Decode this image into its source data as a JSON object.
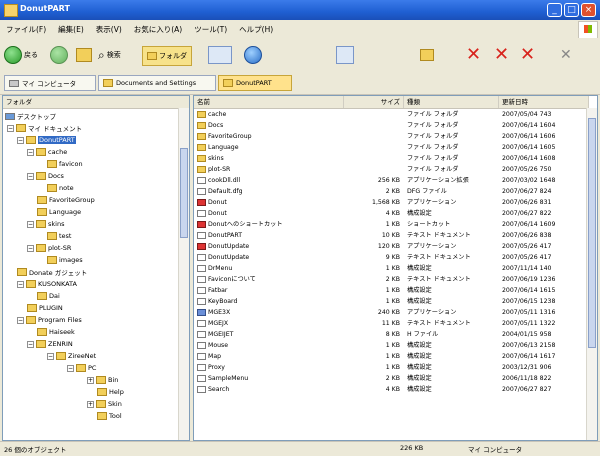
{
  "window": {
    "title": "DonutPART"
  },
  "menu": [
    "ファイル(F)",
    "編集(E)",
    "表示(V)",
    "お気に入り(A)",
    "ツール(T)",
    "ヘルプ(H)"
  ],
  "toolbar": {
    "back_label": "戻る",
    "search_label": "検索",
    "folder_label": "フォルダ"
  },
  "address": {
    "tab1": "マイ コンピュータ",
    "tab2": "Documents and Settings",
    "tab3": "DonutPART"
  },
  "tree": {
    "header": "フォルダ",
    "items": [
      {
        "label": "デスクトップ"
      },
      {
        "label": "マイ ドキュメント"
      },
      {
        "label": "DonutPART"
      },
      {
        "label": "cache"
      },
      {
        "label": "favicon"
      },
      {
        "label": "Docs"
      },
      {
        "label": "note"
      },
      {
        "label": "FavoriteGroup"
      },
      {
        "label": "Language"
      },
      {
        "label": "skins"
      },
      {
        "label": "test"
      },
      {
        "label": "plot-SR"
      },
      {
        "label": "images"
      },
      {
        "label": "Donate ガジェット"
      },
      {
        "label": "KUSONKATA"
      },
      {
        "label": "Dai"
      },
      {
        "label": "PLUGIN"
      },
      {
        "label": "Program Files"
      },
      {
        "label": "Haiseek"
      },
      {
        "label": "ZENRIN"
      },
      {
        "label": "ZireeNet"
      },
      {
        "label": "PC"
      },
      {
        "label": "Bin"
      },
      {
        "label": "Help"
      },
      {
        "label": "Skin"
      },
      {
        "label": "Tool"
      }
    ]
  },
  "list": {
    "columns": [
      "名前",
      "サイズ",
      "種類",
      "更新日時"
    ],
    "rows": [
      {
        "name": "cache",
        "size": "",
        "type": "ファイル フォルダ",
        "date": "2007/05/04 743"
      },
      {
        "name": "Docs",
        "size": "",
        "type": "ファイル フォルダ",
        "date": "2007/06/14 1604"
      },
      {
        "name": "FavoriteGroup",
        "size": "",
        "type": "ファイル フォルダ",
        "date": "2007/06/14 1606"
      },
      {
        "name": "Language",
        "size": "",
        "type": "ファイル フォルダ",
        "date": "2007/06/14 1605"
      },
      {
        "name": "skins",
        "size": "",
        "type": "ファイル フォルダ",
        "date": "2007/06/14 1608"
      },
      {
        "name": "plot-SR",
        "size": "",
        "type": "ファイル フォルダ",
        "date": "2007/05/26 750"
      },
      {
        "name": "cookDll.dll",
        "size": "256 KB",
        "type": "アプリケーション拡張",
        "date": "2007/03/02 1648"
      },
      {
        "name": "Default.dfg",
        "size": "2 KB",
        "type": "DFG ファイル",
        "date": "2007/06/27 824"
      },
      {
        "name": "Donut",
        "size": "1,568 KB",
        "type": "アプリケーション",
        "date": "2007/06/26 831"
      },
      {
        "name": "Donut",
        "size": "4 KB",
        "type": "構成設定",
        "date": "2007/06/27 822"
      },
      {
        "name": "Donutへのショートカット",
        "size": "1 KB",
        "type": "ショートカット",
        "date": "2007/06/14 1609"
      },
      {
        "name": "DonutPART",
        "size": "10 KB",
        "type": "テキスト ドキュメント",
        "date": "2007/06/26 838"
      },
      {
        "name": "DonutUpdate",
        "size": "120 KB",
        "type": "アプリケーション",
        "date": "2007/05/26 417"
      },
      {
        "name": "DonutUpdate",
        "size": "9 KB",
        "type": "テキスト ドキュメント",
        "date": "2007/05/26 417"
      },
      {
        "name": "DrMenu",
        "size": "1 KB",
        "type": "構成設定",
        "date": "2007/11/14 140"
      },
      {
        "name": "Faviconについて",
        "size": "2 KB",
        "type": "テキスト ドキュメント",
        "date": "2007/06/19 1236"
      },
      {
        "name": "Fatbar",
        "size": "1 KB",
        "type": "構成設定",
        "date": "2007/06/14 1615"
      },
      {
        "name": "KeyBoard",
        "size": "1 KB",
        "type": "構成設定",
        "date": "2007/06/15 1238"
      },
      {
        "name": "MGE3X",
        "size": "240 KB",
        "type": "アプリケーション",
        "date": "2007/05/11 1316"
      },
      {
        "name": "MGEJX",
        "size": "11 KB",
        "type": "テキスト ドキュメント",
        "date": "2007/05/11 1322"
      },
      {
        "name": "MGEIJET",
        "size": "8 KB",
        "type": "H ファイル",
        "date": "2004/01/15 958"
      },
      {
        "name": "Mouse",
        "size": "1 KB",
        "type": "構成設定",
        "date": "2007/06/13 2158"
      },
      {
        "name": "Map",
        "size": "1 KB",
        "type": "構成設定",
        "date": "2007/06/14 1617"
      },
      {
        "name": "Proxy",
        "size": "1 KB",
        "type": "構成設定",
        "date": "2003/12/31 906"
      },
      {
        "name": "SampleMenu",
        "size": "2 KB",
        "type": "構成設定",
        "date": "2006/11/18 822"
      },
      {
        "name": "Search",
        "size": "4 KB",
        "type": "構成設定",
        "date": "2007/06/27 827"
      }
    ]
  },
  "status": {
    "left": "26 個のオブジェクト",
    "size": "226 KB",
    "zone": "マイ コンピュータ"
  }
}
